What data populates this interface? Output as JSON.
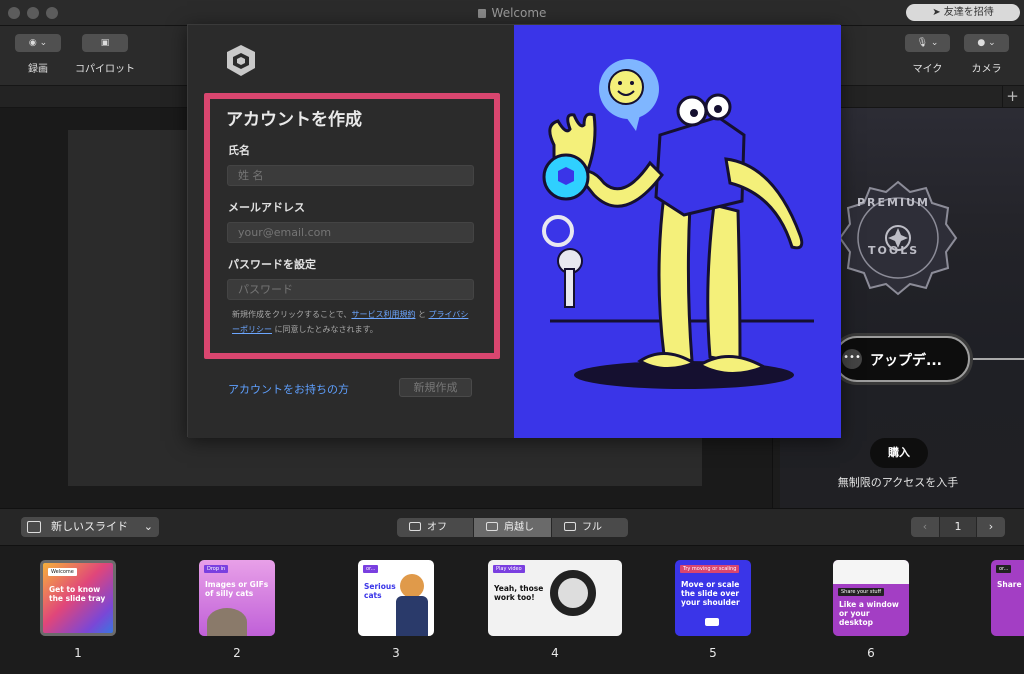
{
  "window": {
    "title": "Welcome",
    "invite_label": "友達を招待"
  },
  "toolbar": {
    "record_label": "録画",
    "copilot_label": "コパイロット",
    "mic_label": "マイク",
    "camera_label": "カメラ"
  },
  "modal": {
    "form_title": "アカウントを作成",
    "name_label": "氏名",
    "name_placeholder": "姓 名",
    "email_label": "メールアドレス",
    "email_placeholder": "your@email.com",
    "password_label": "パスワードを設定",
    "password_placeholder": "パスワード",
    "terms_prefix": "新規作成をクリックすることで、",
    "terms_link1": "サービス利用規約",
    "terms_and": " と ",
    "terms_link2": "プライバシーポリシー",
    "terms_suffix": " に同意したとみなされます。",
    "has_account_link": "アカウントをお持ちの方",
    "create_button": "新規作成"
  },
  "premium": {
    "badge_top": "PREMIUM",
    "badge_bottom": "TOOLS",
    "upgrade_label": "アップデ...",
    "buy_label": "購入",
    "unlimited_text": "無制限のアクセスを入手"
  },
  "bottombar": {
    "new_slide_label": "新しいスライド",
    "mode_off": "オフ",
    "mode_shoulder": "肩越し",
    "mode_full": "フル",
    "current_page": "1"
  },
  "slides": [
    {
      "number": "1",
      "tag": "Welcome",
      "text": "Get to know the slide tray"
    },
    {
      "number": "2",
      "tag": "Drop in",
      "text": "Images or GIFs of silly cats"
    },
    {
      "number": "3",
      "tag": "or...",
      "text": "Serious cats"
    },
    {
      "number": "4",
      "tag": "Play video",
      "text": "Yeah, those work too!"
    },
    {
      "number": "5",
      "tag": "Try moving or scaling",
      "text": "Move or scale the slide over your shoulder"
    },
    {
      "number": "6",
      "tag": "Share your stuff",
      "text": "Like a window or your desktop"
    },
    {
      "number": "",
      "tag": "or...",
      "text": "Share or seco"
    }
  ],
  "colors": {
    "accent_blue": "#3a35e8",
    "highlight_pink": "#d9466f",
    "link_blue": "#5fa0ff",
    "illustration_yellow": "#f4f07a"
  }
}
